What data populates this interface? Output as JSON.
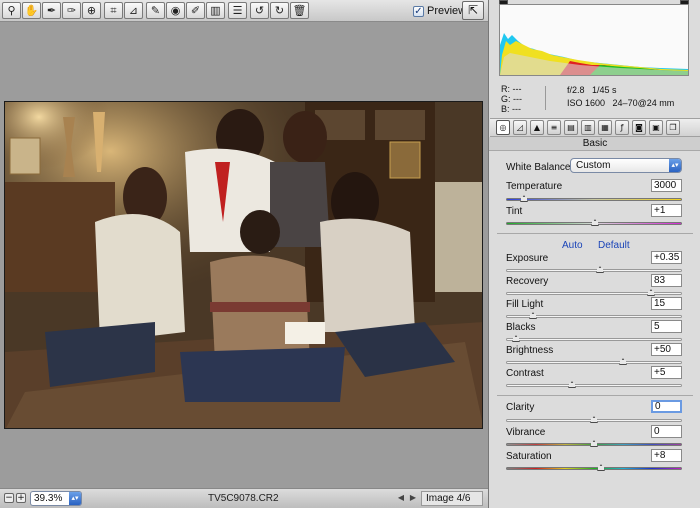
{
  "toolbar": {
    "tools": [
      {
        "name": "zoom-tool",
        "icon": "magnifier-icon",
        "glyph": "⚲"
      },
      {
        "name": "hand-tool",
        "icon": "hand-icon",
        "glyph": "✋"
      },
      {
        "name": "white-balance-tool",
        "icon": "eyedropper-icon",
        "glyph": "✒"
      },
      {
        "name": "color-sampler-tool",
        "icon": "eyedropper-plus-icon",
        "glyph": "✑"
      },
      {
        "name": "target-adjustment-tool",
        "icon": "target-icon",
        "glyph": "⊕"
      },
      {
        "name": "crop-tool",
        "icon": "crop-icon",
        "glyph": "⌗"
      },
      {
        "name": "straighten-tool",
        "icon": "straighten-icon",
        "glyph": "⊿"
      },
      {
        "name": "spot-removal-tool",
        "icon": "brush-icon",
        "glyph": "✎"
      },
      {
        "name": "red-eye-tool",
        "icon": "red-eye-icon",
        "glyph": "◉"
      },
      {
        "name": "adjustment-brush-tool",
        "icon": "adjustment-brush-icon",
        "glyph": "✐"
      },
      {
        "name": "graduated-filter-tool",
        "icon": "graduated-filter-icon",
        "glyph": "▥"
      },
      {
        "name": "preferences-tool",
        "icon": "list-icon",
        "glyph": "☰"
      },
      {
        "name": "rotate-ccw-tool",
        "icon": "rotate-left-icon",
        "glyph": "↺"
      },
      {
        "name": "rotate-cw-tool",
        "icon": "rotate-right-icon",
        "glyph": "↻"
      },
      {
        "name": "delete-tool",
        "icon": "trash-icon",
        "glyph": "🗑"
      }
    ],
    "preview_label": "Preview",
    "preview_checked": true,
    "fullscreen_icon": "fullscreen-toggle-icon"
  },
  "histogram": {
    "r": "R:   ---",
    "g": "G:   ---",
    "b": "B:   ---",
    "aperture": "f/2.8",
    "shutter": "1/45 s",
    "iso": "ISO 1600",
    "lens": "24–70@24 mm"
  },
  "panel": {
    "section_title": "Basic",
    "white_balance_label": "White Balance:",
    "white_balance_value": "Custom",
    "auto_link": "Auto",
    "default_link": "Default",
    "sliders": [
      {
        "key": "temperature",
        "label": "Temperature",
        "value": "3000",
        "pos": 0.1
      },
      {
        "key": "tint",
        "label": "Tint",
        "value": "+1",
        "pos": 0.505
      },
      {
        "key": "exposure",
        "label": "Exposure",
        "value": "+0.35",
        "pos": 0.535
      },
      {
        "key": "recovery",
        "label": "Recovery",
        "value": "83",
        "pos": 0.83
      },
      {
        "key": "fill-light",
        "label": "Fill Light",
        "value": "15",
        "pos": 0.15
      },
      {
        "key": "blacks",
        "label": "Blacks",
        "value": "5",
        "pos": 0.05
      },
      {
        "key": "brightness",
        "label": "Brightness",
        "value": "+50",
        "pos": 0.667
      },
      {
        "key": "contrast",
        "label": "Contrast",
        "value": "+5",
        "pos": 0.375
      },
      {
        "key": "clarity",
        "label": "Clarity",
        "value": "0",
        "pos": 0.5
      },
      {
        "key": "vibrance",
        "label": "Vibrance",
        "value": "0",
        "pos": 0.5
      },
      {
        "key": "saturation",
        "label": "Saturation",
        "value": "+8",
        "pos": 0.54
      }
    ]
  },
  "bottom": {
    "zoom_value": "39.3%",
    "filename": "TV5C9078.CR2",
    "image_count": "Image 4/6"
  }
}
